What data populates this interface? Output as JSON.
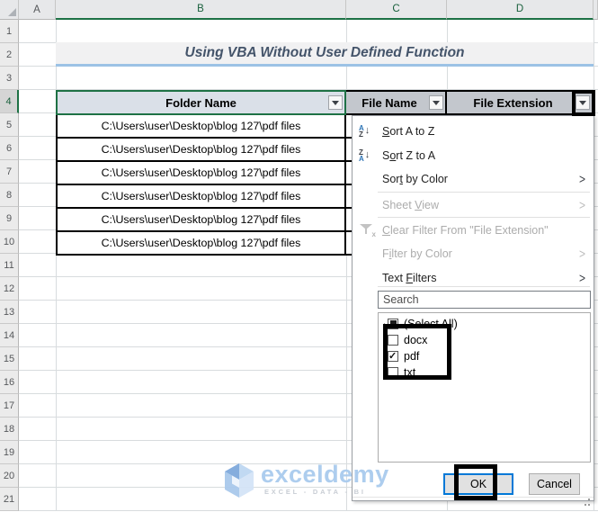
{
  "grid": {
    "column_headers": [
      "A",
      "B",
      "C",
      "D"
    ],
    "row_numbers": [
      "1",
      "2",
      "3",
      "4",
      "5",
      "6",
      "7",
      "8",
      "9",
      "10",
      "11",
      "12",
      "13",
      "14",
      "15",
      "16",
      "17",
      "18",
      "19",
      "20",
      "21"
    ],
    "selected_row": "4",
    "selected_columns": "B:D"
  },
  "title": {
    "text": "Using VBA Without User Defined Function"
  },
  "table": {
    "columns": [
      {
        "label": "Folder Name"
      },
      {
        "label": "File Name"
      },
      {
        "label": "File Extension"
      }
    ],
    "rows": [
      {
        "folder": "C:\\Users\\user\\Desktop\\blog 127\\pdf files"
      },
      {
        "folder": "C:\\Users\\user\\Desktop\\blog 127\\pdf files"
      },
      {
        "folder": "C:\\Users\\user\\Desktop\\blog 127\\pdf files"
      },
      {
        "folder": "C:\\Users\\user\\Desktop\\blog 127\\pdf files"
      },
      {
        "folder": "C:\\Users\\user\\Desktop\\blog 127\\pdf files"
      },
      {
        "folder": "C:\\Users\\user\\Desktop\\blog 127\\pdf files"
      }
    ]
  },
  "filter_menu": {
    "items": [
      {
        "pre": "",
        "key": "S",
        "post": "ort A to Z",
        "state": "enabled"
      },
      {
        "pre": "S",
        "key": "o",
        "post": "rt Z to A",
        "state": "enabled"
      },
      {
        "pre": "Sor",
        "key": "t",
        "post": " by Color",
        "state": "enabled"
      },
      {
        "pre": "Sheet ",
        "key": "V",
        "post": "iew",
        "state": "disabled"
      },
      {
        "pre": "",
        "key": "C",
        "post": "lear Filter From \"File Extension\"",
        "state": "disabled"
      },
      {
        "pre": "F",
        "key": "i",
        "post": "lter by Color",
        "state": "disabled"
      },
      {
        "pre": "Text ",
        "key": "F",
        "post": "ilters",
        "state": "enabled"
      }
    ],
    "search": {
      "placeholder": "Search"
    },
    "checkbox_list": [
      {
        "label": "(Select All)",
        "state": "indeterminate"
      },
      {
        "label": "docx",
        "state": "unchecked"
      },
      {
        "label": "pdf",
        "state": "checked"
      },
      {
        "label": "txt",
        "state": "unchecked"
      }
    ],
    "buttons": {
      "ok": "OK",
      "cancel": "Cancel"
    }
  },
  "icons": {
    "sort_az_top": "A",
    "sort_az_bottom": "Z",
    "sort_za_top": "Z",
    "sort_za_bottom": "A",
    "sort_arrow": "↓",
    "submenu_arrow": ">",
    "funnel_x": "x"
  },
  "watermark": {
    "brand": "exceldemy",
    "tagline": "EXCEL - DATA - BI"
  },
  "colors": {
    "accent_green": "#1E7145",
    "header_fill_active": "#DAE0E8",
    "header_fill": "#C3C7CD",
    "title_text": "#44546A",
    "title_underline": "#9CC2E5",
    "ok_focus_border": "#0078D7",
    "sort_letter_blue": "#2E75B6",
    "watermark_blue": "#A9CBEE",
    "annotation": "#000000"
  }
}
